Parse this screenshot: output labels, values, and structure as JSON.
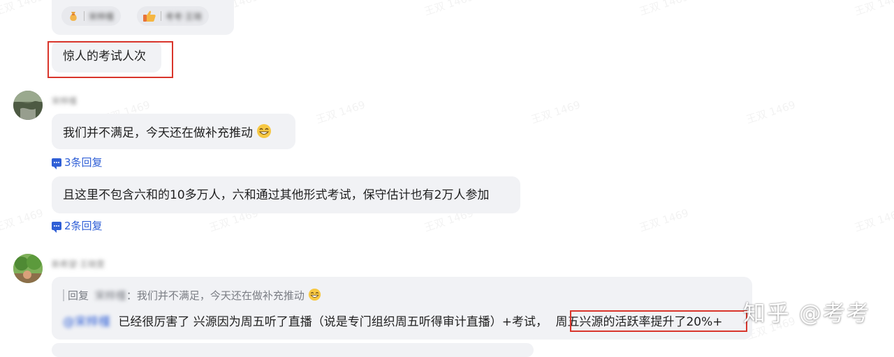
{
  "watermark": "王双 1469",
  "reactions": [
    {
      "icon": "bag-emoji",
      "name": "宋梓槿"
    },
    {
      "icon": "thumbs-up-emoji",
      "name": "考考·王琦"
    }
  ],
  "messages": [
    {
      "text": "惊人的考试人次"
    },
    {
      "sender": "宋梓槿",
      "text": "我们并不满足，今天还在做补充推动"
    },
    {
      "text": "且这里不包含六和的10多万人，六和通过其他形式考试，保守估计也有2万人参加"
    },
    {
      "sender": "新希望·王晓雯"
    }
  ],
  "reply_links": [
    "3条回复",
    "2条回复"
  ],
  "quote": {
    "label": "回复",
    "name": "宋梓槿",
    "text": "：我们并不满足，今天还在做补充推动"
  },
  "last_message": {
    "mention": "@宋梓槿",
    "text": "已经很厉害了 兴源因为周五听了直播（说是专门组织周五听得审计直播）+考试，",
    "highlight": "周五兴源的活跃率提升了20%+"
  },
  "brand": "知乎 @考考",
  "colors": {
    "bubble": "#f1f2f5",
    "link": "#2f5fd6",
    "highlight_box": "#d9352b"
  }
}
